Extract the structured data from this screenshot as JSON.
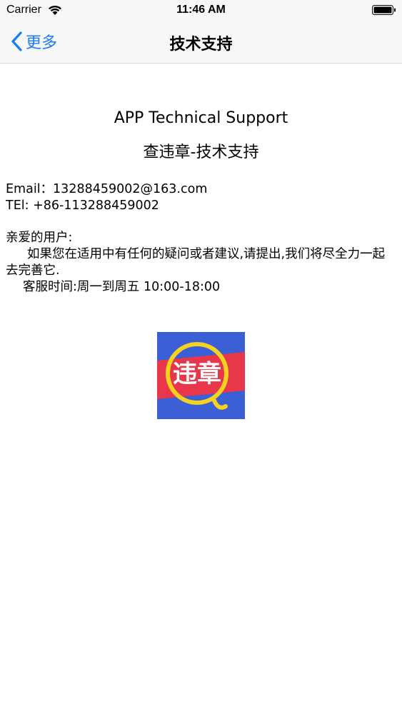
{
  "status_bar": {
    "carrier": "Carrier",
    "time": "11:46 AM"
  },
  "nav": {
    "back_label": "更多",
    "title": "技术支持"
  },
  "content": {
    "heading_en": "APP Technical Support",
    "heading_cn": "查违章-技术支持",
    "email": "Email：13288459002@163.com",
    "tel": "TEl: +86-113288459002",
    "greeting": "亲爱的用户:",
    "paragraph": "如果您在适用中有任何的疑问或者建议,请提出,我们将尽全力一起去完善它.",
    "service_hours": "客服时间:周一到周五 10:00-18:00"
  },
  "logo": {
    "text": "违章",
    "icon": "magnifier-logo-icon"
  },
  "colors": {
    "accent": "#1a7cf5",
    "logo_blue": "#3b5fd4",
    "logo_red": "#e8374a",
    "logo_yellow": "#f4d21f"
  }
}
